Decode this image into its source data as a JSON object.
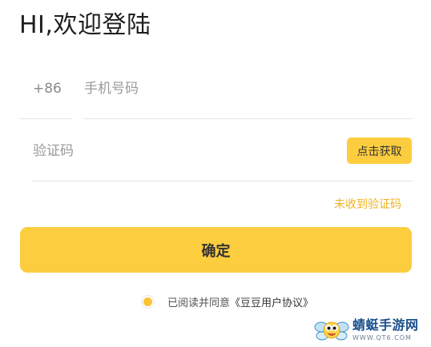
{
  "header": {
    "title": "HI,欢迎登陆"
  },
  "phone": {
    "country_code": "+86",
    "placeholder": "手机号码",
    "value": ""
  },
  "verification": {
    "placeholder": "验证码",
    "value": "",
    "get_code_label": "点击获取",
    "not_received_label": "未收到验证码"
  },
  "confirm_label": "确定",
  "agreement": {
    "checked": true,
    "text": "已阅读并同意",
    "link_text": "《豆豆用户协议》"
  },
  "watermark": {
    "name": "蜻蜓手游网",
    "url": "WWW.QT6.COM"
  },
  "colors": {
    "accent": "#fccd3f",
    "link": "#f0b222",
    "divider": "#e6e6e6"
  },
  "icons": {
    "agree_radio": "radio-checked-icon",
    "watermark_logo": "dragonfly-logo-icon"
  }
}
